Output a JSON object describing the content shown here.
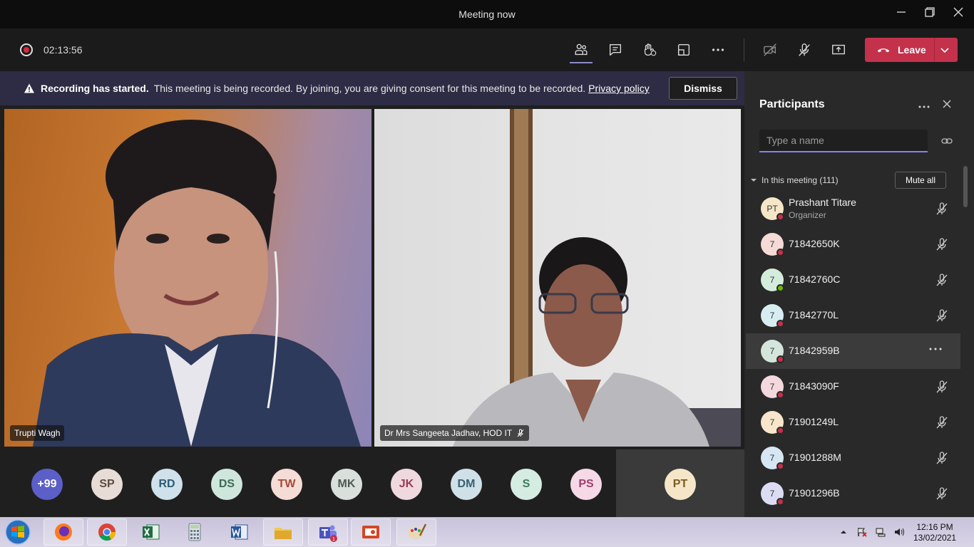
{
  "window": {
    "title": "Meeting now"
  },
  "toolbar": {
    "timer": "02:13:56",
    "leave_label": "Leave"
  },
  "banner": {
    "bold": "Recording has started.",
    "message": "This meeting is being recorded. By joining, you are giving consent for this meeting to be recorded.",
    "link": "Privacy policy",
    "dismiss": "Dismiss"
  },
  "videos": [
    {
      "name": "Trupti Wagh"
    },
    {
      "name": "Dr Mrs Sangeeta Jadhav, HOD IT"
    }
  ],
  "avatar_row": [
    {
      "initials": "+99",
      "bg": "#5b5fc7",
      "fg": "#ffffff"
    },
    {
      "initials": "SP",
      "bg": "#e8dcd6",
      "fg": "#5b4b43"
    },
    {
      "initials": "RD",
      "bg": "#cfe1ea",
      "fg": "#2e5b74"
    },
    {
      "initials": "DS",
      "bg": "#cfe6dc",
      "fg": "#3c6b54"
    },
    {
      "initials": "TW",
      "bg": "#f6dcd6",
      "fg": "#a24b3a"
    },
    {
      "initials": "MK",
      "bg": "#d9e0dc",
      "fg": "#4c5b53"
    },
    {
      "initials": "JK",
      "bg": "#f0d8df",
      "fg": "#9c3b58"
    },
    {
      "initials": "DM",
      "bg": "#cfe0e8",
      "fg": "#3a6073"
    },
    {
      "initials": "S",
      "bg": "#d5ece2",
      "fg": "#3c7a5b"
    },
    {
      "initials": "PS",
      "bg": "#f5d9e6",
      "fg": "#a33c6e"
    },
    {
      "initials": "PT",
      "bg": "#f6e6c8",
      "fg": "#7a5c22"
    }
  ],
  "panel": {
    "title": "Participants",
    "search_placeholder": "Type a name",
    "section_label": "In this meeting (111)",
    "mute_all": "Mute all",
    "participants": [
      {
        "initials": "PT",
        "name": "Prashant Titare",
        "role": "Organizer",
        "avatar_bg": "#f6e6c8",
        "status": "#c4314b"
      },
      {
        "initials": "7",
        "name": "71842650K",
        "avatar_bg": "#f5dad6",
        "status": "#c4314b"
      },
      {
        "initials": "7",
        "name": "71842760C",
        "avatar_bg": "#d4ecdc",
        "status": "#6bb700"
      },
      {
        "initials": "7",
        "name": "71842770L",
        "avatar_bg": "#d6eef2",
        "status": "#c4314b"
      },
      {
        "initials": "7",
        "name": "71842959B",
        "avatar_bg": "#d4e6dc",
        "status": "#c4314b"
      },
      {
        "initials": "7",
        "name": "71843090F",
        "avatar_bg": "#f3d8dd",
        "status": "#c4314b"
      },
      {
        "initials": "7",
        "name": "71901249L",
        "avatar_bg": "#f8e6cc",
        "status": "#c4314b"
      },
      {
        "initials": "7",
        "name": "71901288M",
        "avatar_bg": "#d6e6f2",
        "status": "#c4314b"
      },
      {
        "initials": "7",
        "name": "71901296B",
        "avatar_bg": "#dcdcf4",
        "status": "#c4314b"
      }
    ]
  },
  "taskbar": {
    "apps": [
      "firefox",
      "chrome",
      "excel",
      "calculator",
      "word",
      "file-explorer",
      "teams",
      "powerpoint",
      "paint"
    ],
    "teams_badge": "1",
    "time": "12:16 PM",
    "date": "13/02/2021"
  }
}
